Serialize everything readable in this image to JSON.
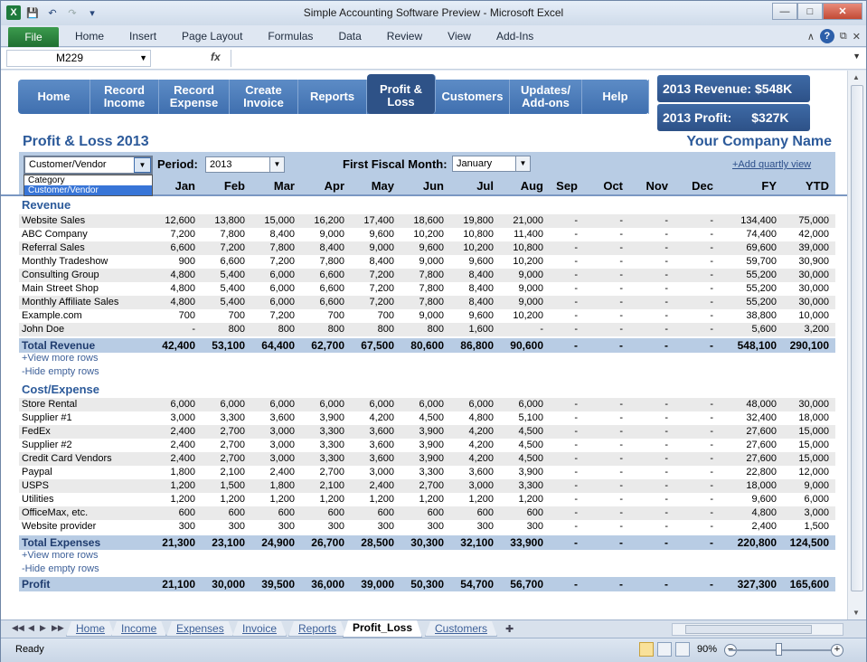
{
  "window": {
    "title": "Simple Accounting Software Preview  -  Microsoft Excel"
  },
  "ribbon": {
    "file": "File",
    "tabs": [
      "Home",
      "Insert",
      "Page Layout",
      "Formulas",
      "Data",
      "Review",
      "View",
      "Add-Ins"
    ]
  },
  "formula_bar": {
    "name_box": "M229",
    "fx": "fx",
    "value": ""
  },
  "nav": {
    "items": [
      "Home",
      "Record\nIncome",
      "Record\nExpense",
      "Create\nInvoice",
      "Reports",
      "Profit &\nLoss",
      "Customers",
      "Updates/\nAdd-ons",
      "Help"
    ],
    "active_index": 5
  },
  "kpi": {
    "revenue": "2013 Revenue: $548K",
    "profit_label": "2013 Profit:",
    "profit_value": "$327K"
  },
  "report": {
    "title": "Profit & Loss 2013",
    "company": "Your Company Name"
  },
  "filter": {
    "grouping_value": "Customer/Vendor",
    "grouping_options": [
      "Category",
      "Customer/Vendor"
    ],
    "grouping_highlighted": 1,
    "period_label": "Period:",
    "period_value": "2013",
    "fiscal_label": "First Fiscal Month:",
    "fiscal_value": "January",
    "add_quarterly": "+Add quartly view"
  },
  "columns": [
    "Jan",
    "Feb",
    "Mar",
    "Apr",
    "May",
    "Jun",
    "Jul",
    "Aug",
    "Sep",
    "Oct",
    "Nov",
    "Dec",
    "FY",
    "YTD"
  ],
  "revenue": {
    "title": "Revenue",
    "rows": [
      {
        "label": "Website Sales",
        "values": [
          "12,600",
          "13,800",
          "15,000",
          "16,200",
          "17,400",
          "18,600",
          "19,800",
          "21,000",
          "-",
          "-",
          "-",
          "-",
          "134,400",
          "75,000"
        ]
      },
      {
        "label": "ABC Company",
        "values": [
          "7,200",
          "7,800",
          "8,400",
          "9,000",
          "9,600",
          "10,200",
          "10,800",
          "11,400",
          "-",
          "-",
          "-",
          "-",
          "74,400",
          "42,000"
        ]
      },
      {
        "label": "Referral Sales",
        "values": [
          "6,600",
          "7,200",
          "7,800",
          "8,400",
          "9,000",
          "9,600",
          "10,200",
          "10,800",
          "-",
          "-",
          "-",
          "-",
          "69,600",
          "39,000"
        ]
      },
      {
        "label": "Monthly Tradeshow",
        "values": [
          "900",
          "6,600",
          "7,200",
          "7,800",
          "8,400",
          "9,000",
          "9,600",
          "10,200",
          "-",
          "-",
          "-",
          "-",
          "59,700",
          "30,900"
        ]
      },
      {
        "label": "Consulting Group",
        "values": [
          "4,800",
          "5,400",
          "6,000",
          "6,600",
          "7,200",
          "7,800",
          "8,400",
          "9,000",
          "-",
          "-",
          "-",
          "-",
          "55,200",
          "30,000"
        ]
      },
      {
        "label": "Main Street Shop",
        "values": [
          "4,800",
          "5,400",
          "6,000",
          "6,600",
          "7,200",
          "7,800",
          "8,400",
          "9,000",
          "-",
          "-",
          "-",
          "-",
          "55,200",
          "30,000"
        ]
      },
      {
        "label": "Monthly Affiliate Sales",
        "values": [
          "4,800",
          "5,400",
          "6,000",
          "6,600",
          "7,200",
          "7,800",
          "8,400",
          "9,000",
          "-",
          "-",
          "-",
          "-",
          "55,200",
          "30,000"
        ]
      },
      {
        "label": "Example.com",
        "values": [
          "700",
          "700",
          "7,200",
          "700",
          "700",
          "9,000",
          "9,600",
          "10,200",
          "-",
          "-",
          "-",
          "-",
          "38,800",
          "10,000"
        ]
      },
      {
        "label": "John Doe",
        "values": [
          "-",
          "800",
          "800",
          "800",
          "800",
          "800",
          "1,600",
          "-",
          "-",
          "-",
          "-",
          "-",
          "5,600",
          "3,200"
        ]
      }
    ],
    "total": {
      "label": "Total Revenue",
      "values": [
        "42,400",
        "53,100",
        "64,400",
        "62,700",
        "67,500",
        "80,600",
        "86,800",
        "90,600",
        "-",
        "-",
        "-",
        "-",
        "548,100",
        "290,100"
      ]
    },
    "view_more": "+View more rows",
    "hide_empty": "-Hide empty rows"
  },
  "expense": {
    "title": "Cost/Expense",
    "rows": [
      {
        "label": "Store Rental",
        "values": [
          "6,000",
          "6,000",
          "6,000",
          "6,000",
          "6,000",
          "6,000",
          "6,000",
          "6,000",
          "-",
          "-",
          "-",
          "-",
          "48,000",
          "30,000"
        ]
      },
      {
        "label": "Supplier #1",
        "values": [
          "3,000",
          "3,300",
          "3,600",
          "3,900",
          "4,200",
          "4,500",
          "4,800",
          "5,100",
          "-",
          "-",
          "-",
          "-",
          "32,400",
          "18,000"
        ]
      },
      {
        "label": "FedEx",
        "values": [
          "2,400",
          "2,700",
          "3,000",
          "3,300",
          "3,600",
          "3,900",
          "4,200",
          "4,500",
          "-",
          "-",
          "-",
          "-",
          "27,600",
          "15,000"
        ]
      },
      {
        "label": "Supplier #2",
        "values": [
          "2,400",
          "2,700",
          "3,000",
          "3,300",
          "3,600",
          "3,900",
          "4,200",
          "4,500",
          "-",
          "-",
          "-",
          "-",
          "27,600",
          "15,000"
        ]
      },
      {
        "label": "Credit Card Vendors",
        "values": [
          "2,400",
          "2,700",
          "3,000",
          "3,300",
          "3,600",
          "3,900",
          "4,200",
          "4,500",
          "-",
          "-",
          "-",
          "-",
          "27,600",
          "15,000"
        ]
      },
      {
        "label": "Paypal",
        "values": [
          "1,800",
          "2,100",
          "2,400",
          "2,700",
          "3,000",
          "3,300",
          "3,600",
          "3,900",
          "-",
          "-",
          "-",
          "-",
          "22,800",
          "12,000"
        ]
      },
      {
        "label": "USPS",
        "values": [
          "1,200",
          "1,500",
          "1,800",
          "2,100",
          "2,400",
          "2,700",
          "3,000",
          "3,300",
          "-",
          "-",
          "-",
          "-",
          "18,000",
          "9,000"
        ]
      },
      {
        "label": "Utilities",
        "values": [
          "1,200",
          "1,200",
          "1,200",
          "1,200",
          "1,200",
          "1,200",
          "1,200",
          "1,200",
          "-",
          "-",
          "-",
          "-",
          "9,600",
          "6,000"
        ]
      },
      {
        "label": "OfficeMax, etc.",
        "values": [
          "600",
          "600",
          "600",
          "600",
          "600",
          "600",
          "600",
          "600",
          "-",
          "-",
          "-",
          "-",
          "4,800",
          "3,000"
        ]
      },
      {
        "label": "Website provider",
        "values": [
          "300",
          "300",
          "300",
          "300",
          "300",
          "300",
          "300",
          "300",
          "-",
          "-",
          "-",
          "-",
          "2,400",
          "1,500"
        ]
      }
    ],
    "total": {
      "label": "Total Expenses",
      "values": [
        "21,300",
        "23,100",
        "24,900",
        "26,700",
        "28,500",
        "30,300",
        "32,100",
        "33,900",
        "-",
        "-",
        "-",
        "-",
        "220,800",
        "124,500"
      ]
    },
    "view_more": "+View more rows",
    "hide_empty": "-Hide empty rows"
  },
  "profit": {
    "label": "Profit",
    "values": [
      "21,100",
      "30,000",
      "39,500",
      "36,000",
      "39,000",
      "50,300",
      "54,700",
      "56,700",
      "-",
      "-",
      "-",
      "-",
      "327,300",
      "165,600"
    ]
  },
  "sheet_tabs": [
    "Home",
    "Income",
    "Expenses",
    "Invoice",
    "Reports",
    "Profit_Loss",
    "Customers"
  ],
  "active_sheet": 5,
  "status": {
    "ready": "Ready",
    "zoom": "90%"
  }
}
